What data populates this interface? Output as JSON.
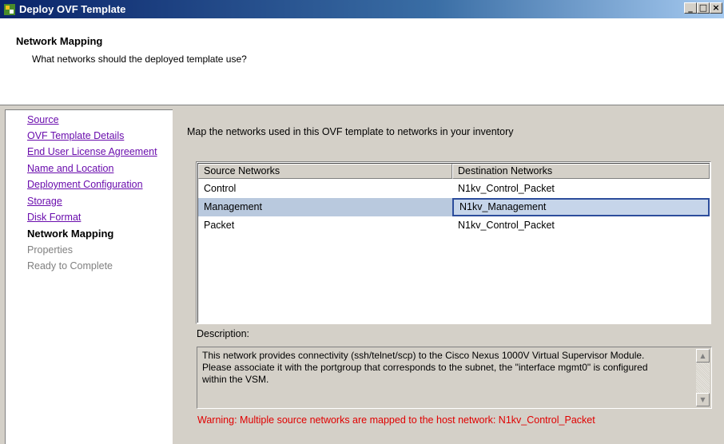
{
  "window": {
    "title": "Deploy OVF Template",
    "icon": "ovf-deploy-icon",
    "controls": [
      "minimize",
      "maximize",
      "close"
    ]
  },
  "header": {
    "title": "Network Mapping",
    "subtitle": "What networks should the deployed template use?"
  },
  "sidebar": {
    "items": [
      {
        "label": "Source",
        "state": "link"
      },
      {
        "label": "OVF Template Details",
        "state": "link"
      },
      {
        "label": "End User License Agreement",
        "state": "link"
      },
      {
        "label": "Name and Location",
        "state": "link"
      },
      {
        "label": "Deployment Configuration",
        "state": "link"
      },
      {
        "label": "Storage",
        "state": "link"
      },
      {
        "label": "Disk Format",
        "state": "link"
      },
      {
        "label": "Network Mapping",
        "state": "current"
      },
      {
        "label": "Properties",
        "state": "disabled"
      },
      {
        "label": "Ready to Complete",
        "state": "disabled"
      }
    ]
  },
  "main": {
    "intro": "Map the networks used in this OVF template to networks in your inventory",
    "table": {
      "columns": [
        "Source Networks",
        "Destination Networks"
      ],
      "rows": [
        {
          "source": "Control",
          "destination": "N1kv_Control_Packet",
          "selected": false
        },
        {
          "source": "Management",
          "destination": "N1kv_Management",
          "selected": true
        },
        {
          "source": "Packet",
          "destination": "N1kv_Control_Packet",
          "selected": false
        }
      ]
    },
    "description_label": "Description:",
    "description_text": "This network provides connectivity (ssh/telnet/scp) to the Cisco Nexus 1000V Virtual Supervisor Module. Please associate it with the portgroup that corresponds to the subnet, the \"interface mgmt0\" is configured within the VSM.",
    "warning": "Warning: Multiple source networks are mapped to the host network: N1kv_Control_Packet"
  },
  "colors": {
    "title_bar": "#0a246a",
    "link": "#6a0dad",
    "warning": "#e00000",
    "selection": "#b9c9de"
  }
}
